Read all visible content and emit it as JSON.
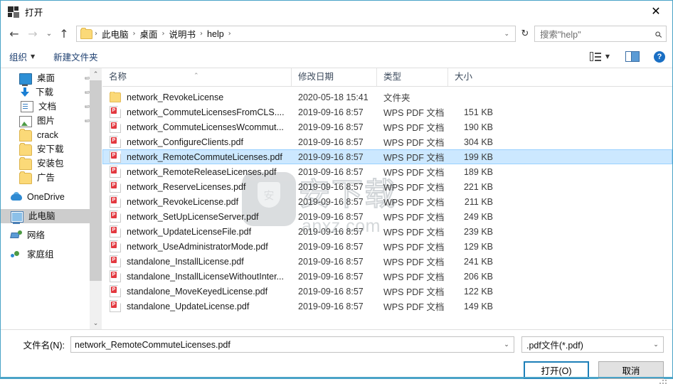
{
  "window": {
    "title": "打开",
    "title_icon": "open-file-icon",
    "close_label": "✕"
  },
  "address_bar": {
    "back_icon": "←",
    "forward_icon": "→",
    "history_icon": "⌄",
    "up_icon": "↑",
    "breadcrumb": [
      "此电脑",
      "桌面",
      "说明书",
      "help"
    ],
    "separator": "›",
    "dropdown_icon": "⌄",
    "refresh_icon": "↻",
    "search_placeholder": "搜索\"help\"",
    "search_icon": "⚲"
  },
  "command_bar": {
    "organize_label": "组织",
    "organize_caret": "▼",
    "new_folder_label": "新建文件夹",
    "view_caret": "▼",
    "help_label": "?"
  },
  "sidebar": {
    "items": [
      {
        "label": "桌面",
        "icon": "desktop-icon",
        "icon_class": "ic-desktop",
        "pinned": true,
        "indent": true
      },
      {
        "label": "下载",
        "icon": "download-icon",
        "icon_class": "ic-download",
        "pinned": true,
        "indent": true
      },
      {
        "label": "文档",
        "icon": "documents-icon",
        "icon_class": "ic-doc",
        "pinned": true,
        "indent": true
      },
      {
        "label": "图片",
        "icon": "pictures-icon",
        "icon_class": "ic-pic",
        "pinned": true,
        "indent": true
      },
      {
        "label": "crack",
        "icon": "folder-icon",
        "icon_class": "ic-folder",
        "pinned": false,
        "indent": true
      },
      {
        "label": "安下载",
        "icon": "folder-icon",
        "icon_class": "ic-folder",
        "pinned": false,
        "indent": true
      },
      {
        "label": "安装包",
        "icon": "folder-icon",
        "icon_class": "ic-folder",
        "pinned": false,
        "indent": true
      },
      {
        "label": "广告",
        "icon": "folder-icon",
        "icon_class": "ic-folder",
        "pinned": false,
        "indent": true
      },
      {
        "label": "OneDrive",
        "icon": "onedrive-icon",
        "icon_class": "ic-onedrive",
        "pinned": false,
        "indent": false,
        "gap_before": true
      },
      {
        "label": "此电脑",
        "icon": "this-pc-icon",
        "icon_class": "ic-pc",
        "pinned": false,
        "indent": false,
        "selected": true,
        "gap_before": true
      },
      {
        "label": "网络",
        "icon": "network-icon",
        "icon_class": "ic-network",
        "pinned": false,
        "indent": false,
        "gap_before": true
      },
      {
        "label": "家庭组",
        "icon": "homegroup-icon",
        "icon_class": "ic-home",
        "pinned": false,
        "indent": false,
        "gap_before": true
      }
    ],
    "pin_icon": "📌",
    "scroll_up_icon": "⌃",
    "scroll_down_icon": "⌄"
  },
  "file_list": {
    "columns": [
      "名称",
      "修改日期",
      "类型",
      "大小"
    ],
    "sort_indicator": "⌃",
    "rows": [
      {
        "name": "network_RevokeLicense",
        "date": "2020-05-18 15:41",
        "type": "文件夹",
        "size": "",
        "icon": "folder-icon",
        "kind": "folder",
        "selected": false
      },
      {
        "name": "network_CommuteLicensesFromCLS....",
        "date": "2019-09-16 8:57",
        "type": "WPS PDF 文档",
        "size": "151 KB",
        "icon": "pdf-file-icon",
        "kind": "pdf",
        "selected": false
      },
      {
        "name": "network_CommuteLicensesWcommut...",
        "date": "2019-09-16 8:57",
        "type": "WPS PDF 文档",
        "size": "190 KB",
        "icon": "pdf-file-icon",
        "kind": "pdf",
        "selected": false
      },
      {
        "name": "network_ConfigureClients.pdf",
        "date": "2019-09-16 8:57",
        "type": "WPS PDF 文档",
        "size": "304 KB",
        "icon": "pdf-file-icon",
        "kind": "pdf",
        "selected": false
      },
      {
        "name": "network_RemoteCommuteLicenses.pdf",
        "date": "2019-09-16 8:57",
        "type": "WPS PDF 文档",
        "size": "199 KB",
        "icon": "pdf-file-icon",
        "kind": "pdf",
        "selected": true
      },
      {
        "name": "network_RemoteReleaseLicenses.pdf",
        "date": "2019-09-16 8:57",
        "type": "WPS PDF 文档",
        "size": "189 KB",
        "icon": "pdf-file-icon",
        "kind": "pdf",
        "selected": false
      },
      {
        "name": "network_ReserveLicenses.pdf",
        "date": "2019-09-16 8:57",
        "type": "WPS PDF 文档",
        "size": "221 KB",
        "icon": "pdf-file-icon",
        "kind": "pdf",
        "selected": false
      },
      {
        "name": "network_RevokeLicense.pdf",
        "date": "2019-09-16 8:57",
        "type": "WPS PDF 文档",
        "size": "211 KB",
        "icon": "pdf-file-icon",
        "kind": "pdf",
        "selected": false
      },
      {
        "name": "network_SetUpLicenseServer.pdf",
        "date": "2019-09-16 8:57",
        "type": "WPS PDF 文档",
        "size": "249 KB",
        "icon": "pdf-file-icon",
        "kind": "pdf",
        "selected": false
      },
      {
        "name": "network_UpdateLicenseFile.pdf",
        "date": "2019-09-16 8:57",
        "type": "WPS PDF 文档",
        "size": "239 KB",
        "icon": "pdf-file-icon",
        "kind": "pdf",
        "selected": false
      },
      {
        "name": "network_UseAdministratorMode.pdf",
        "date": "2019-09-16 8:57",
        "type": "WPS PDF 文档",
        "size": "129 KB",
        "icon": "pdf-file-icon",
        "kind": "pdf",
        "selected": false
      },
      {
        "name": "standalone_InstallLicense.pdf",
        "date": "2019-09-16 8:57",
        "type": "WPS PDF 文档",
        "size": "241 KB",
        "icon": "pdf-file-icon",
        "kind": "pdf",
        "selected": false
      },
      {
        "name": "standalone_InstallLicenseWithoutInter...",
        "date": "2019-09-16 8:57",
        "type": "WPS PDF 文档",
        "size": "206 KB",
        "icon": "pdf-file-icon",
        "kind": "pdf",
        "selected": false
      },
      {
        "name": "standalone_MoveKeyedLicense.pdf",
        "date": "2019-09-16 8:57",
        "type": "WPS PDF 文档",
        "size": "122 KB",
        "icon": "pdf-file-icon",
        "kind": "pdf",
        "selected": false
      },
      {
        "name": "standalone_UpdateLicense.pdf",
        "date": "2019-09-16 8:57",
        "type": "WPS PDF 文档",
        "size": "149 KB",
        "icon": "pdf-file-icon",
        "kind": "pdf",
        "selected": false
      }
    ]
  },
  "watermark": {
    "shield_char": "安",
    "text": "安下载",
    "url": "anxz.com"
  },
  "footer": {
    "filename_label": "文件名(N):",
    "filename_value": "network_RemoteCommuteLicenses.pdf",
    "filetype_value": ".pdf文件(*.pdf)",
    "dropdown_icon": "⌄",
    "open_button": "打开(O)",
    "cancel_button": "取消"
  },
  "colors": {
    "window_border": "#4aa3c7",
    "selection_fill": "#cce8ff",
    "selection_border": "#99d1ff",
    "accent_button": "#1d7fb8",
    "link_text": "#1a3c6e",
    "sidebar_selected": "#cdcdcd"
  }
}
